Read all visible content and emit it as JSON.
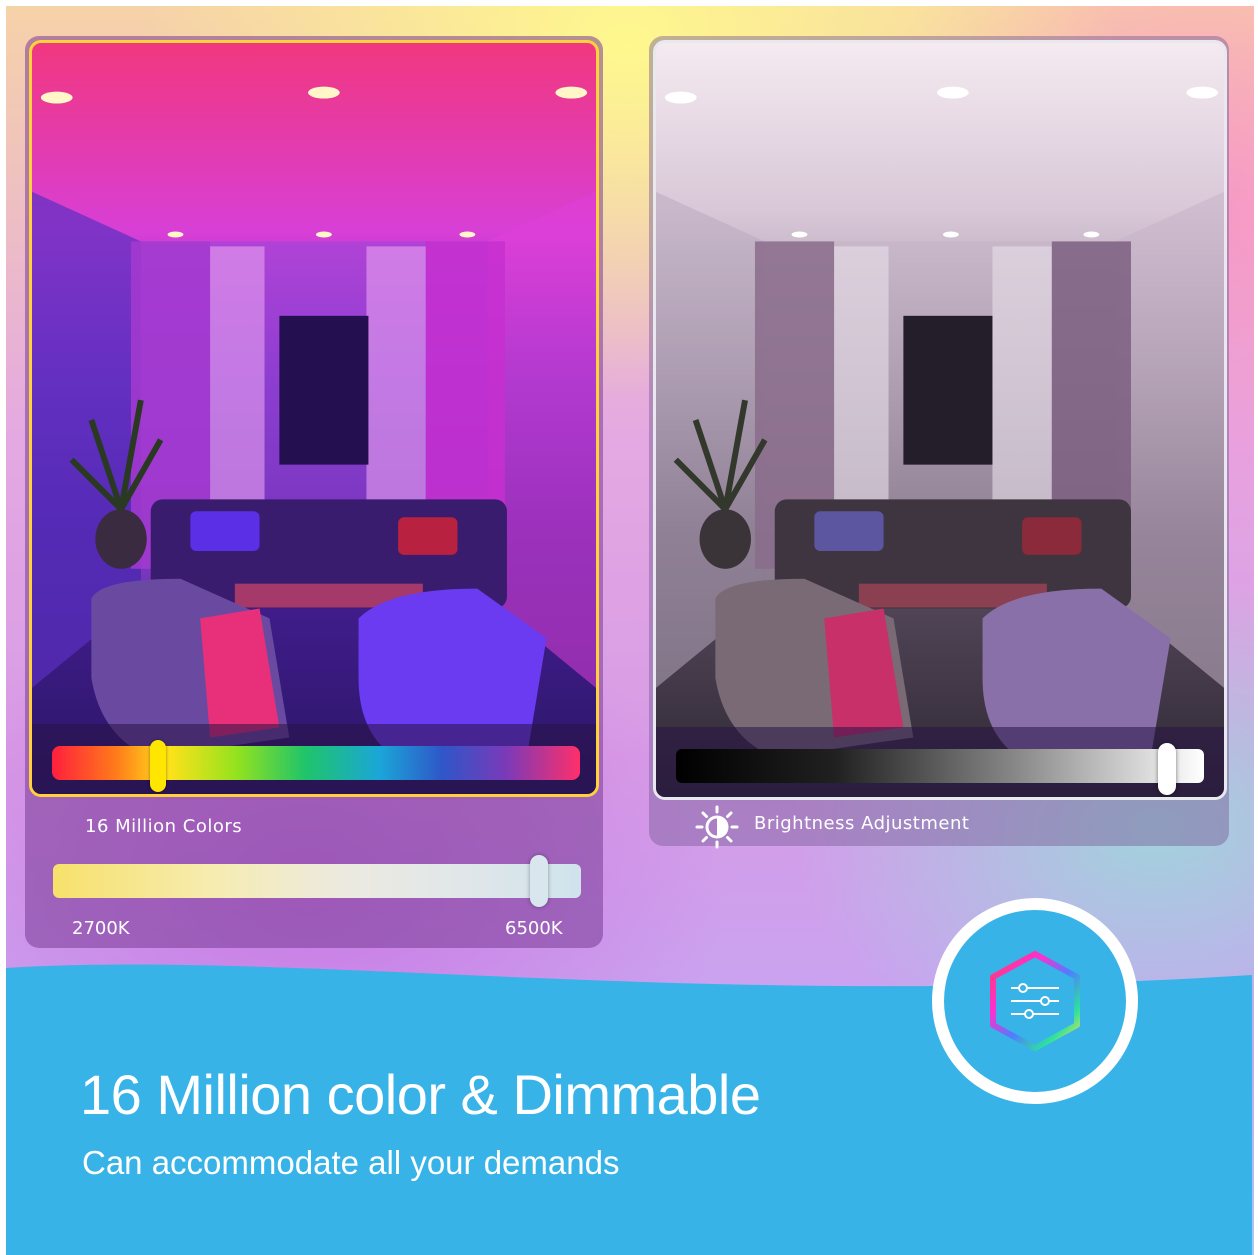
{
  "color_panel": {
    "caption": "16 Million Colors",
    "temp_min_label": "2700K",
    "temp_max_label": "6500K",
    "color_slider_value": 0.2,
    "temp_slider_value": 0.92
  },
  "brightness_panel": {
    "caption": "Brightness Adjustment",
    "brightness_value": 0.93,
    "icon": "brightness-icon"
  },
  "banner": {
    "headline": "16 Million color & Dimmable",
    "subline": "Can accommodate all your demands",
    "badge_icon": "sliders-hexagon-icon"
  },
  "colors": {
    "banner_blue": "#37b3e8",
    "accent_yellow": "#ffe600"
  }
}
